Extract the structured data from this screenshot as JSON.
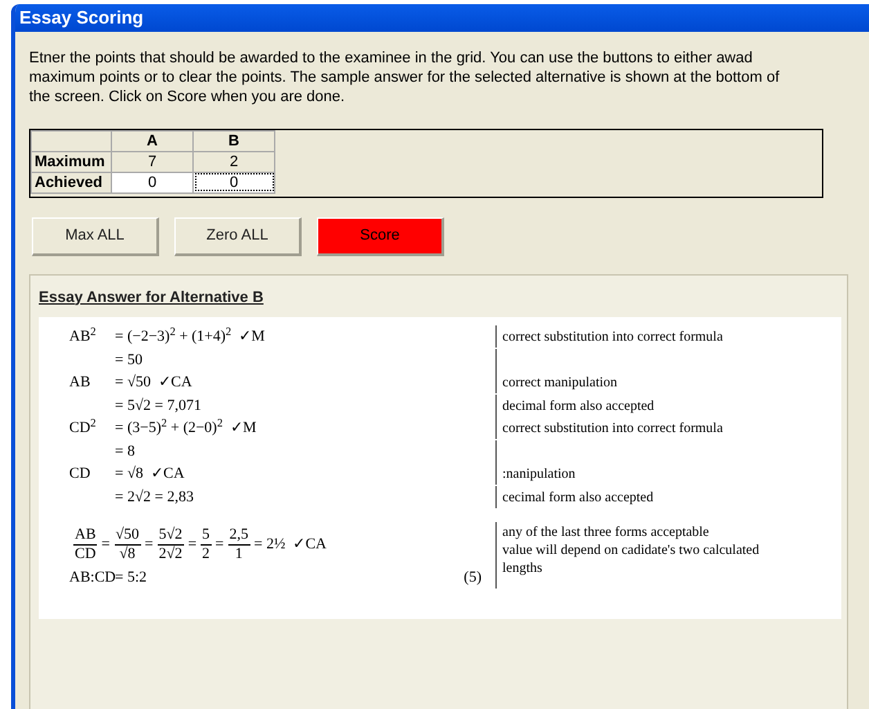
{
  "window": {
    "title": "Essay Scoring"
  },
  "instructions": "Etner the points that should be awarded to the examinee in the grid.  You can use the buttons to either awad maximum points or to clear the points.  The sample answer for the selected alternative is shown at the bottom of the screen.  Click on Score when you are done.",
  "grid": {
    "columns": [
      "A",
      "B"
    ],
    "rows": [
      {
        "label": "Maximum",
        "kind": "fixed",
        "cells": [
          {
            "value": "7",
            "focused": false
          },
          {
            "value": "2",
            "focused": false
          }
        ]
      },
      {
        "label": "Achieved",
        "kind": "input",
        "cells": [
          {
            "value": "0",
            "focused": false
          },
          {
            "value": "0",
            "focused": true
          }
        ]
      }
    ]
  },
  "buttons": [
    {
      "label": "Max ALL",
      "kind": "normal"
    },
    {
      "label": "Zero ALL",
      "kind": "normal"
    },
    {
      "label": "Score",
      "kind": "primary"
    }
  ],
  "answer": {
    "heading": "Essay Answer for Alternative B",
    "rows": [
      {
        "lhs": "AB$^{2}$",
        "rhs": [
          {
            "kind": "text",
            "text": "= (−2−3)$^{2}$ + (1+4)$^{2}$  ✓M"
          }
        ],
        "notes": [
          "correct substitution into correct formula"
        ]
      },
      {
        "rhs": [
          {
            "kind": "text",
            "text": "= 50"
          }
        ],
        "notes": []
      },
      {
        "lhs": "AB",
        "rhs": [
          {
            "kind": "text",
            "text": "= √50  ✓CA"
          }
        ],
        "notes": [
          "correct manipulation"
        ]
      },
      {
        "rhs": [
          {
            "kind": "text",
            "text": "= 5√2 = 7,071"
          }
        ],
        "notes": [
          "decimal form also accepted"
        ]
      },
      {
        "lhs": "CD$^{2}$",
        "rhs": [
          {
            "kind": "text",
            "text": "= (3−5)$^{2}$ + (2−0)$^{2}$  ✓M"
          }
        ],
        "notes": [
          "correct substitution into correct formula"
        ]
      },
      {
        "rhs": [
          {
            "kind": "text",
            "text": "= 8"
          }
        ],
        "notes": []
      },
      {
        "lhs": "CD",
        "rhs": [
          {
            "kind": "text",
            "text": "= √8  ✓CA"
          }
        ],
        "notes": [
          ":nanipulation"
        ]
      },
      {
        "rhs": [
          {
            "kind": "text",
            "text": "= 2√2 = 2,83"
          }
        ],
        "notes": [
          "cecimal form also accepted"
        ]
      },
      {
        "rhs": [
          {
            "kind": "frac",
            "num": "AB",
            "den": "CD"
          },
          {
            "kind": "text",
            "text": "="
          },
          {
            "kind": "frac",
            "num": "√50",
            "den": "√8"
          },
          {
            "kind": "text",
            "text": "="
          },
          {
            "kind": "frac",
            "num": "5√2",
            "den": "2√2"
          },
          {
            "kind": "text",
            "text": "="
          },
          {
            "kind": "frac",
            "num": "5",
            "den": "2"
          },
          {
            "kind": "text",
            "text": "="
          },
          {
            "kind": "frac",
            "num": "2,5",
            "den": "1"
          },
          {
            "kind": "text",
            "text": "= 2½  ✓CA"
          }
        ],
        "notes": [
          "any of the last three forms acceptable",
          "value will depend on cadidate's two calculated",
          "lengths"
        ]
      },
      {
        "lhs": "AB:CD",
        "rhs": [
          {
            "kind": "text",
            "text": "= 5:2"
          }
        ],
        "marks": "(5)",
        "notes": []
      }
    ]
  }
}
